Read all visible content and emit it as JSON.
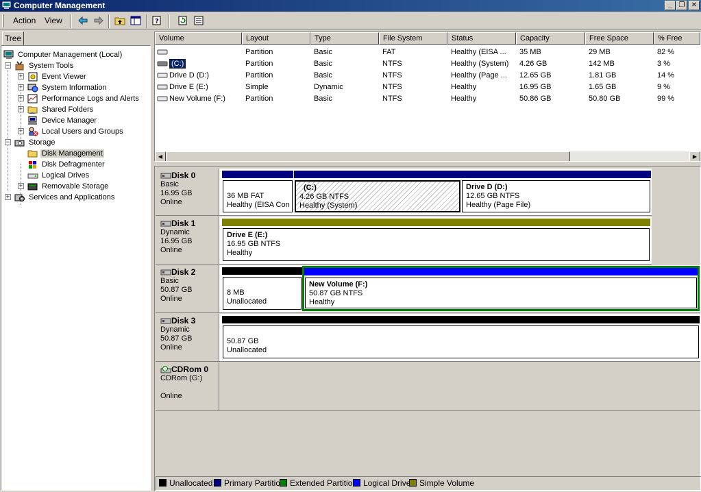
{
  "window": {
    "title": "Computer Management",
    "controls": {
      "minimize": "_",
      "restore": "❐",
      "close": "✕"
    }
  },
  "menu": {
    "items": [
      {
        "label": "Action"
      },
      {
        "label": "View"
      }
    ]
  },
  "toolbar": {
    "buttons": [
      "back-arrow-icon",
      "forward-arrow-icon",
      "up-folder-icon",
      "show-hide-tree-icon",
      "help-icon",
      "refresh-icon",
      "properties-icon"
    ]
  },
  "tree": {
    "tab_label": "Tree",
    "nodes": [
      {
        "label": "Computer Management (Local)",
        "icon": "computer-icon",
        "expander": ""
      },
      {
        "label": "System Tools",
        "icon": "tools-icon",
        "expander": "−"
      },
      {
        "label": "Event Viewer",
        "icon": "event-viewer-icon",
        "expander": "+"
      },
      {
        "label": "System Information",
        "icon": "system-info-icon",
        "expander": "+"
      },
      {
        "label": "Performance Logs and Alerts",
        "icon": "performance-icon",
        "expander": "+"
      },
      {
        "label": "Shared Folders",
        "icon": "shared-folder-icon",
        "expander": "+"
      },
      {
        "label": "Device Manager",
        "icon": "device-manager-icon",
        "expander": ""
      },
      {
        "label": "Local Users and Groups",
        "icon": "users-groups-icon",
        "expander": "+"
      },
      {
        "label": "Storage",
        "icon": "storage-icon",
        "expander": "−"
      },
      {
        "label": "Disk Management",
        "icon": "disk-management-icon",
        "expander": ""
      },
      {
        "label": "Disk Defragmenter",
        "icon": "defragmenter-icon",
        "expander": ""
      },
      {
        "label": "Logical Drives",
        "icon": "logical-drives-icon",
        "expander": ""
      },
      {
        "label": "Removable Storage",
        "icon": "removable-storage-icon",
        "expander": "+"
      },
      {
        "label": "Services and Applications",
        "icon": "services-icon",
        "expander": "+"
      }
    ]
  },
  "volumes": {
    "columns": [
      "Volume",
      "Layout",
      "Type",
      "File System",
      "Status",
      "Capacity",
      "Free Space",
      "% Free"
    ],
    "rows": [
      [
        "",
        "Partition",
        "Basic",
        "FAT",
        "Healthy (EISA ...",
        "35 MB",
        "29 MB",
        "82 %"
      ],
      [
        "(C:)",
        "Partition",
        "Basic",
        "NTFS",
        "Healthy (System)",
        "4.26 GB",
        "142 MB",
        "3 %"
      ],
      [
        "Drive D (D:)",
        "Partition",
        "Basic",
        "NTFS",
        "Healthy (Page ...",
        "12.65 GB",
        "1.81 GB",
        "14 %"
      ],
      [
        "Drive E (E:)",
        "Simple",
        "Dynamic",
        "NTFS",
        "Healthy",
        "16.95 GB",
        "1.65 GB",
        "9 %"
      ],
      [
        "New Volume (F:)",
        "Partition",
        "Basic",
        "NTFS",
        "Healthy",
        "50.86 GB",
        "50.80 GB",
        "99 %"
      ]
    ]
  },
  "disks": [
    {
      "name": "Disk 0",
      "type": "Basic",
      "size": "16.95 GB",
      "status": "Online",
      "partitions": [
        {
          "name": "",
          "line2": "36 MB FAT",
          "line3": "Healthy (EISA Con"
        },
        {
          "name": "(C:)",
          "line2": "4.26 GB NTFS",
          "line3": "Healthy (System)"
        },
        {
          "name": "Drive D  (D:)",
          "line2": "12.65 GB NTFS",
          "line3": "Healthy (Page File)"
        }
      ]
    },
    {
      "name": "Disk 1",
      "type": "Dynamic",
      "size": "16.95 GB",
      "status": "Online",
      "partitions": [
        {
          "name": "Drive E  (E:)",
          "line2": "16.95 GB NTFS",
          "line3": "Healthy"
        }
      ]
    },
    {
      "name": "Disk 2",
      "type": "Basic",
      "size": "50.87 GB",
      "status": "Online",
      "partitions": [
        {
          "name": "",
          "line2": "8 MB",
          "line3": "Unallocated"
        },
        {
          "name": "New Volume  (F:)",
          "line2": "50.87 GB NTFS",
          "line3": "Healthy"
        }
      ]
    },
    {
      "name": "Disk 3",
      "type": "Dynamic",
      "size": "50.87 GB",
      "status": "Online",
      "partitions": [
        {
          "name": "",
          "line2": "50.87 GB",
          "line3": "Unallocated"
        }
      ]
    },
    {
      "name": "CDRom 0",
      "type": "CDRom (G:)",
      "size": "",
      "status": "Online",
      "partitions": []
    }
  ],
  "legend": [
    {
      "label": "Unallocated",
      "color": "#000000"
    },
    {
      "label": "Primary Partition",
      "color": "#000080"
    },
    {
      "label": "Extended Partition",
      "color": "#008000"
    },
    {
      "label": "Logical Drive",
      "color": "#0000ff"
    },
    {
      "label": "Simple Volume",
      "color": "#808000"
    }
  ]
}
